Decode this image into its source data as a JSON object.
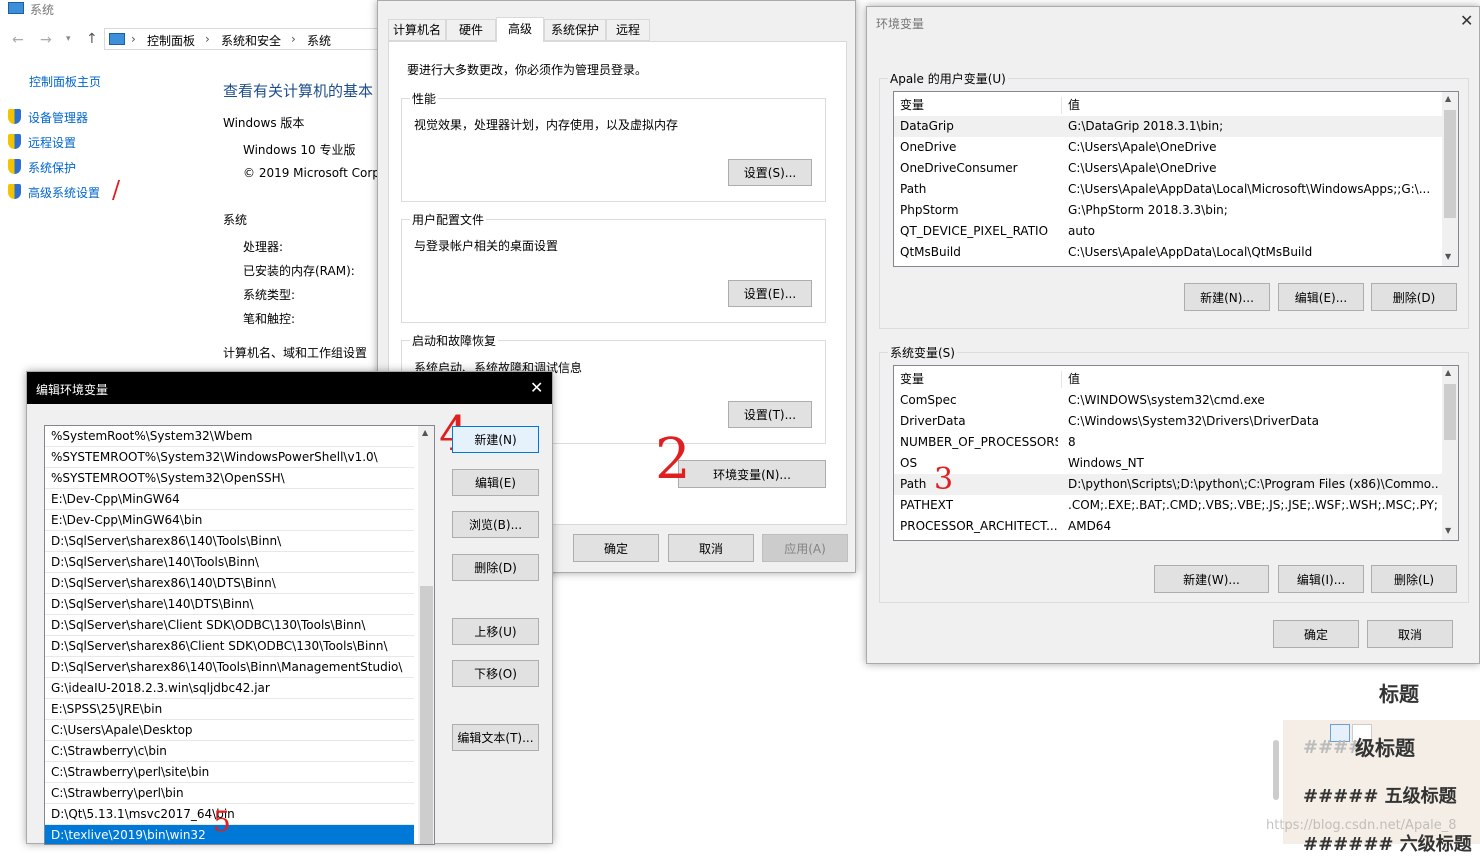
{
  "sys_window": {
    "title": "系统",
    "breadcrumb": [
      "控制面板",
      "系统和安全",
      "系统"
    ],
    "home_link": "控制面板主页",
    "left_links": [
      "设备管理器",
      "远程设置",
      "系统保护",
      "高级系统设置"
    ],
    "heading": "查看有关计算机的基本",
    "windows_edition_label": "Windows 版本",
    "edition": "Windows 10 专业版",
    "copyright": "© 2019 Microsoft Corp",
    "system_label": "系统",
    "processor_label": "处理器:",
    "ram_label": "已安装的内存(RAM):",
    "type_label": "系统类型:",
    "pen_label": "笔和触控:",
    "computer_name_label": "计算机名、域和工作组设置"
  },
  "sysprops": {
    "tabs": [
      "计算机名",
      "硬件",
      "高级",
      "系统保护",
      "远程"
    ],
    "admin_note": "要进行大多数更改，你必须作为管理员登录。",
    "perf_label": "性能",
    "perf_desc": "视觉效果，处理器计划，内存使用，以及虚拟内存",
    "perf_btn": "设置(S)...",
    "profile_label": "用户配置文件",
    "profile_desc": "与登录帐户相关的桌面设置",
    "profile_btn": "设置(E)...",
    "startup_label": "启动和故障恢复",
    "startup_desc": "系统启动、系统故障和调试信息",
    "startup_btn": "设置(T)...",
    "env_btn": "环境变量(N)...",
    "ok": "确定",
    "cancel": "取消",
    "apply": "应用(A)"
  },
  "envvars": {
    "title": "环境变量",
    "user_group": "Apale 的用户变量(U)",
    "col_var": "变量",
    "col_val": "值",
    "user_vars": [
      {
        "name": "DataGrip",
        "value": "G:\\DataGrip 2018.3.1\\bin;"
      },
      {
        "name": "OneDrive",
        "value": "C:\\Users\\Apale\\OneDrive"
      },
      {
        "name": "OneDriveConsumer",
        "value": "C:\\Users\\Apale\\OneDrive"
      },
      {
        "name": "Path",
        "value": "C:\\Users\\Apale\\AppData\\Local\\Microsoft\\WindowsApps;;G:\\..."
      },
      {
        "name": "PhpStorm",
        "value": "G:\\PhpStorm 2018.3.3\\bin;"
      },
      {
        "name": "QT_DEVICE_PIXEL_RATIO",
        "value": "auto"
      },
      {
        "name": "QtMsBuild",
        "value": "C:\\Users\\Apale\\AppData\\Local\\QtMsBuild"
      }
    ],
    "user_new": "新建(N)...",
    "user_edit": "编辑(E)...",
    "user_delete": "删除(D)",
    "sys_group": "系统变量(S)",
    "sys_vars": [
      {
        "name": "ComSpec",
        "value": "C:\\WINDOWS\\system32\\cmd.exe"
      },
      {
        "name": "DriverData",
        "value": "C:\\Windows\\System32\\Drivers\\DriverData"
      },
      {
        "name": "NUMBER_OF_PROCESSORS",
        "value": "8"
      },
      {
        "name": "OS",
        "value": "Windows_NT"
      },
      {
        "name": "Path",
        "value": "D:\\python\\Scripts\\;D:\\python\\;C:\\Program Files (x86)\\Commo..."
      },
      {
        "name": "PATHEXT",
        "value": ".COM;.EXE;.BAT;.CMD;.VBS;.VBE;.JS;.JSE;.WSF;.WSH;.MSC;.PY;.P..."
      },
      {
        "name": "PROCESSOR_ARCHITECT...",
        "value": "AMD64"
      }
    ],
    "sys_new": "新建(W)...",
    "sys_edit": "编辑(I)...",
    "sys_delete": "删除(L)",
    "ok": "确定",
    "cancel": "取消"
  },
  "edit_dialog": {
    "title": "编辑环境变量",
    "items": [
      "%SystemRoot%\\System32\\Wbem",
      "%SYSTEMROOT%\\System32\\WindowsPowerShell\\v1.0\\",
      "%SYSTEMROOT%\\System32\\OpenSSH\\",
      "E:\\Dev-Cpp\\MinGW64",
      "E:\\Dev-Cpp\\MinGW64\\bin",
      "D:\\SqlServer\\sharex86\\140\\Tools\\Binn\\",
      "D:\\SqlServer\\share\\140\\Tools\\Binn\\",
      "D:\\SqlServer\\sharex86\\140\\DTS\\Binn\\",
      "D:\\SqlServer\\share\\140\\DTS\\Binn\\",
      "D:\\SqlServer\\share\\Client SDK\\ODBC\\130\\Tools\\Binn\\",
      "D:\\SqlServer\\sharex86\\Client SDK\\ODBC\\130\\Tools\\Binn\\",
      "D:\\SqlServer\\sharex86\\140\\Tools\\Binn\\ManagementStudio\\",
      "G:\\ideaIU-2018.2.3.win\\sqljdbc42.jar",
      "E:\\SPSS\\25\\JRE\\bin",
      "C:\\Users\\Apale\\Desktop",
      "C:\\Strawberry\\c\\bin",
      "C:\\Strawberry\\perl\\site\\bin",
      "C:\\Strawberry\\perl\\bin",
      "D:\\Qt\\5.13.1\\msvc2017_64\\bin",
      "D:\\texlive\\2019\\bin\\win32"
    ],
    "new": "新建(N)",
    "edit": "编辑(E)",
    "browse": "浏览(B)...",
    "delete": "删除(D)",
    "up": "上移(U)",
    "down": "下移(O)",
    "edit_text": "编辑文本(T)..."
  },
  "background": {
    "heading4": "标题",
    "heading4_full": "级标题",
    "heading5": "##### 五级标题",
    "heading6": "###### 六级标题",
    "watermark": "https://blog.csdn.net/Apale_8",
    "hash4": "####"
  },
  "annotations": [
    "/",
    "2",
    "3",
    "4",
    "5"
  ],
  "colors": {
    "accent": "#0078d7",
    "selected": "#0078d7",
    "link": "#0066cc",
    "annotation": "#e02020"
  }
}
